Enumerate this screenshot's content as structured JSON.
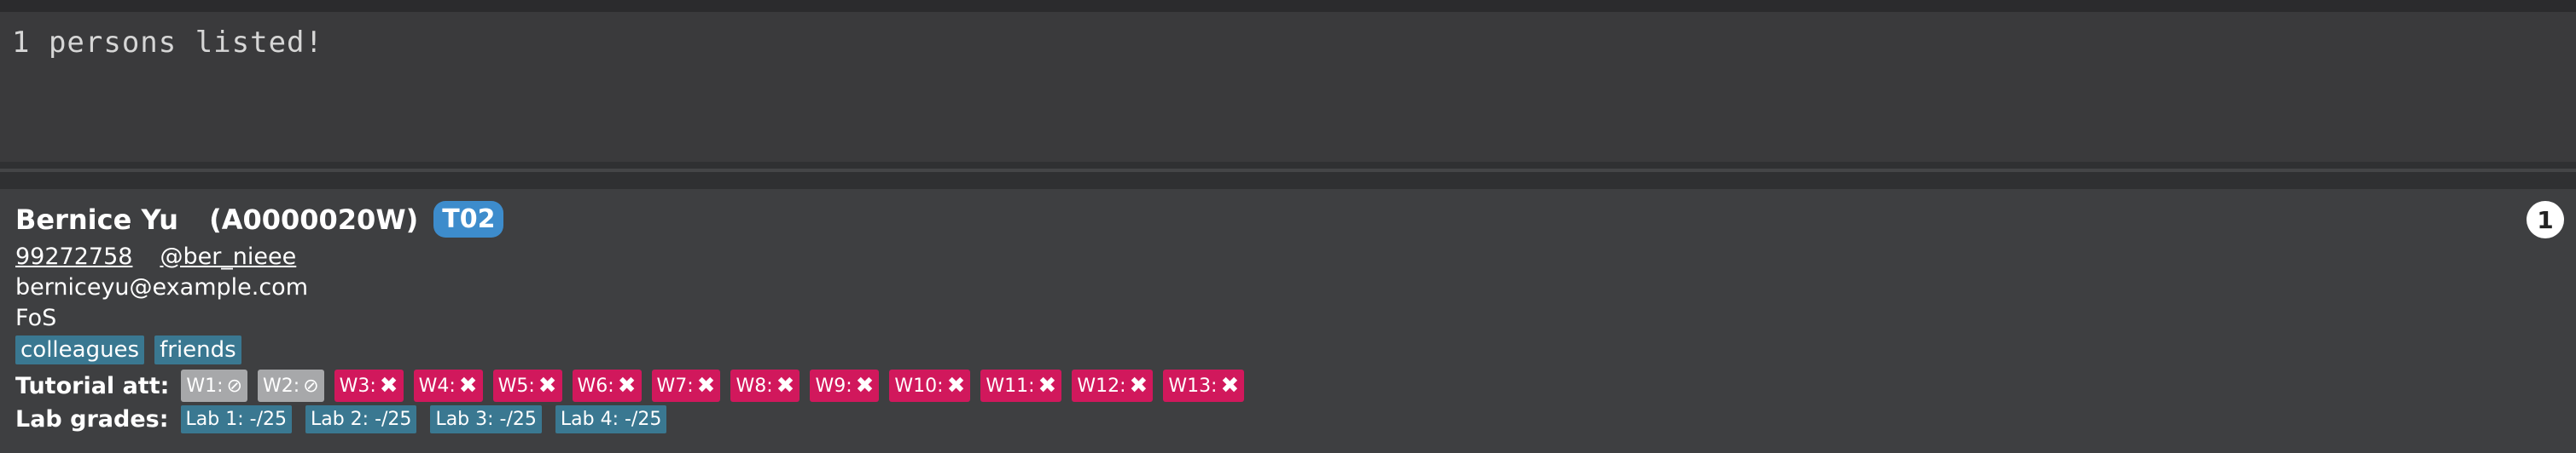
{
  "result": {
    "message": "1 persons listed!"
  },
  "person": {
    "index": "1",
    "name": "Bernice Yu",
    "student_id": "(A0000020W)",
    "tutorial": "T02",
    "phone": "99272758",
    "telegram": "@ber_nieee",
    "email": "berniceyu@example.com",
    "faculty": "FoS",
    "tags": [
      "colleagues",
      "friends"
    ],
    "attendance_label": "Tutorial att:",
    "attendance": [
      {
        "week": "W1:",
        "status": "excused",
        "icon": "excused-icon"
      },
      {
        "week": "W2:",
        "status": "excused",
        "icon": "excused-icon"
      },
      {
        "week": "W3:",
        "status": "absent",
        "icon": "cross-icon"
      },
      {
        "week": "W4:",
        "status": "absent",
        "icon": "cross-icon"
      },
      {
        "week": "W5:",
        "status": "absent",
        "icon": "cross-icon"
      },
      {
        "week": "W6:",
        "status": "absent",
        "icon": "cross-icon"
      },
      {
        "week": "W7:",
        "status": "absent",
        "icon": "cross-icon"
      },
      {
        "week": "W8:",
        "status": "absent",
        "icon": "cross-icon"
      },
      {
        "week": "W9:",
        "status": "absent",
        "icon": "cross-icon"
      },
      {
        "week": "W10:",
        "status": "absent",
        "icon": "cross-icon"
      },
      {
        "week": "W11:",
        "status": "absent",
        "icon": "cross-icon"
      },
      {
        "week": "W12:",
        "status": "absent",
        "icon": "cross-icon"
      },
      {
        "week": "W13:",
        "status": "absent",
        "icon": "cross-icon"
      }
    ],
    "grades_label": "Lab grades:",
    "lab_grades": [
      "Lab 1: -/25",
      "Lab 2: -/25",
      "Lab 3: -/25",
      "Lab 4: -/25"
    ]
  },
  "colors": {
    "tutorial_badge": "#3d8ccc",
    "tag": "#3a7891",
    "excused": "#a7a8aa",
    "absent": "#d1185c"
  }
}
